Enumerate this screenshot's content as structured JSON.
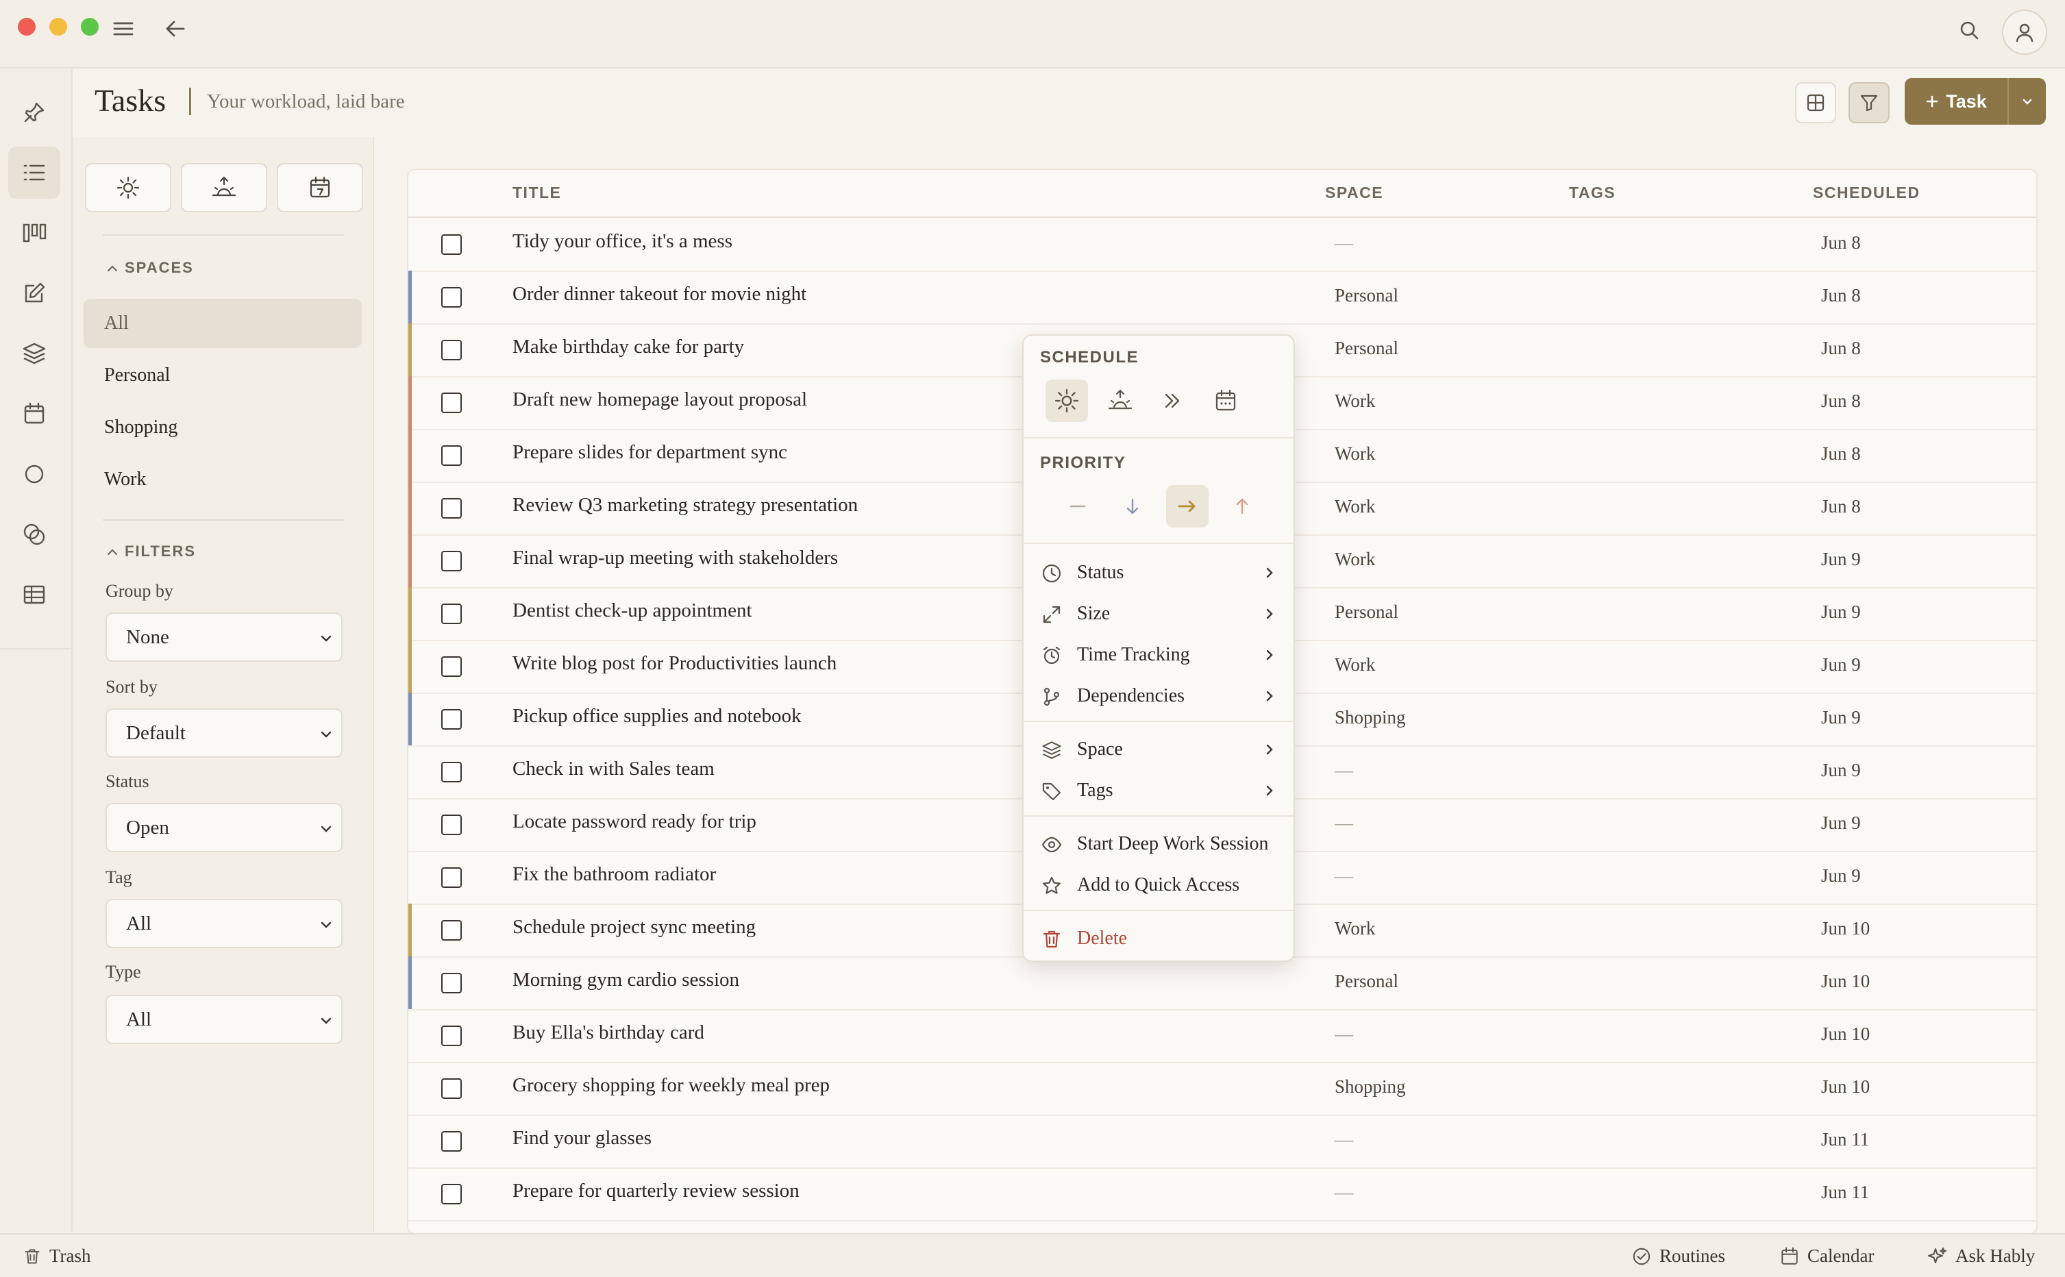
{
  "header": {
    "title": "Tasks",
    "subtitle": "Your workload, laid bare",
    "new_task_label": "Task"
  },
  "sidebar": {
    "spaces_heading": "SPACES",
    "spaces": [
      "All",
      "Personal",
      "Shopping",
      "Work"
    ],
    "filters_heading": "FILTERS",
    "filters": {
      "group_by": {
        "label": "Group by",
        "value": "None"
      },
      "sort_by": {
        "label": "Sort by",
        "value": "Default"
      },
      "status": {
        "label": "Status",
        "value": "Open"
      },
      "tag": {
        "label": "Tag",
        "value": "All"
      },
      "type": {
        "label": "Type",
        "value": "All"
      }
    }
  },
  "table": {
    "columns": {
      "title": "TITLE",
      "space": "SPACE",
      "tags": "TAGS",
      "scheduled": "SCHEDULED"
    },
    "rows": [
      {
        "title": "Tidy your office, it's a mess",
        "space": "—",
        "scheduled": "Jun 8",
        "color": ""
      },
      {
        "title": "Order dinner takeout for movie night",
        "space": "Personal",
        "scheduled": "Jun 8",
        "color": "#7d8fb3"
      },
      {
        "title": "Make birthday cake for party",
        "space": "Personal",
        "scheduled": "Jun 8",
        "color": "#c2a25a"
      },
      {
        "title": "Draft new homepage layout proposal",
        "space": "Work",
        "scheduled": "Jun 8",
        "color": "#c98a6e"
      },
      {
        "title": "Prepare slides for department sync",
        "space": "Work",
        "scheduled": "Jun 8",
        "color": "#c98a6e"
      },
      {
        "title": "Review Q3 marketing strategy presentation",
        "space": "Work",
        "scheduled": "Jun 8",
        "color": "#c98a6e"
      },
      {
        "title": "Final wrap-up meeting with stakeholders",
        "space": "Work",
        "scheduled": "Jun 9",
        "color": "#c98a6e"
      },
      {
        "title": "Dentist check-up appointment",
        "space": "Personal",
        "scheduled": "Jun 9",
        "color": "#c2a25a"
      },
      {
        "title": "Write blog post for Productivities launch",
        "space": "Work",
        "scheduled": "Jun 9",
        "color": "#c2a25a"
      },
      {
        "title": "Pickup office supplies and notebook",
        "space": "Shopping",
        "scheduled": "Jun 9",
        "color": "#7d8fb3"
      },
      {
        "title": "Check in with Sales team",
        "space": "—",
        "scheduled": "Jun 9",
        "color": ""
      },
      {
        "title": "Locate password ready for trip",
        "space": "—",
        "scheduled": "Jun 9",
        "color": ""
      },
      {
        "title": "Fix the bathroom radiator",
        "space": "—",
        "scheduled": "Jun 9",
        "color": ""
      },
      {
        "title": "Schedule project sync meeting",
        "space": "Work",
        "scheduled": "Jun 10",
        "color": "#c2a25a"
      },
      {
        "title": "Morning gym cardio session",
        "space": "Personal",
        "scheduled": "Jun 10",
        "color": "#7d8fb3"
      },
      {
        "title": "Buy Ella's birthday card",
        "space": "—",
        "scheduled": "Jun 10",
        "color": ""
      },
      {
        "title": "Grocery shopping for weekly meal prep",
        "space": "Shopping",
        "scheduled": "Jun 10",
        "color": ""
      },
      {
        "title": "Find your glasses",
        "space": "—",
        "scheduled": "Jun 11",
        "color": ""
      },
      {
        "title": "Prepare for quarterly review session",
        "space": "—",
        "scheduled": "Jun 11",
        "color": ""
      }
    ]
  },
  "context_menu": {
    "schedule_heading": "SCHEDULE",
    "priority_heading": "PRIORITY",
    "items": {
      "status": "Status",
      "size": "Size",
      "time_tracking": "Time Tracking",
      "dependencies": "Dependencies",
      "space": "Space",
      "tags": "Tags",
      "deep_work": "Start Deep Work Session",
      "quick_access": "Add to Quick Access",
      "delete": "Delete"
    }
  },
  "bottom_bar": {
    "trash": "Trash",
    "routines": "Routines",
    "calendar": "Calendar",
    "ask": "Ask Hably"
  },
  "colors": {
    "accent": "#8c7648",
    "delete": "#b0483a",
    "space_work": "#c98a6e",
    "space_personal": "#c2a25a",
    "space_shopping": "#7d8fb3"
  }
}
